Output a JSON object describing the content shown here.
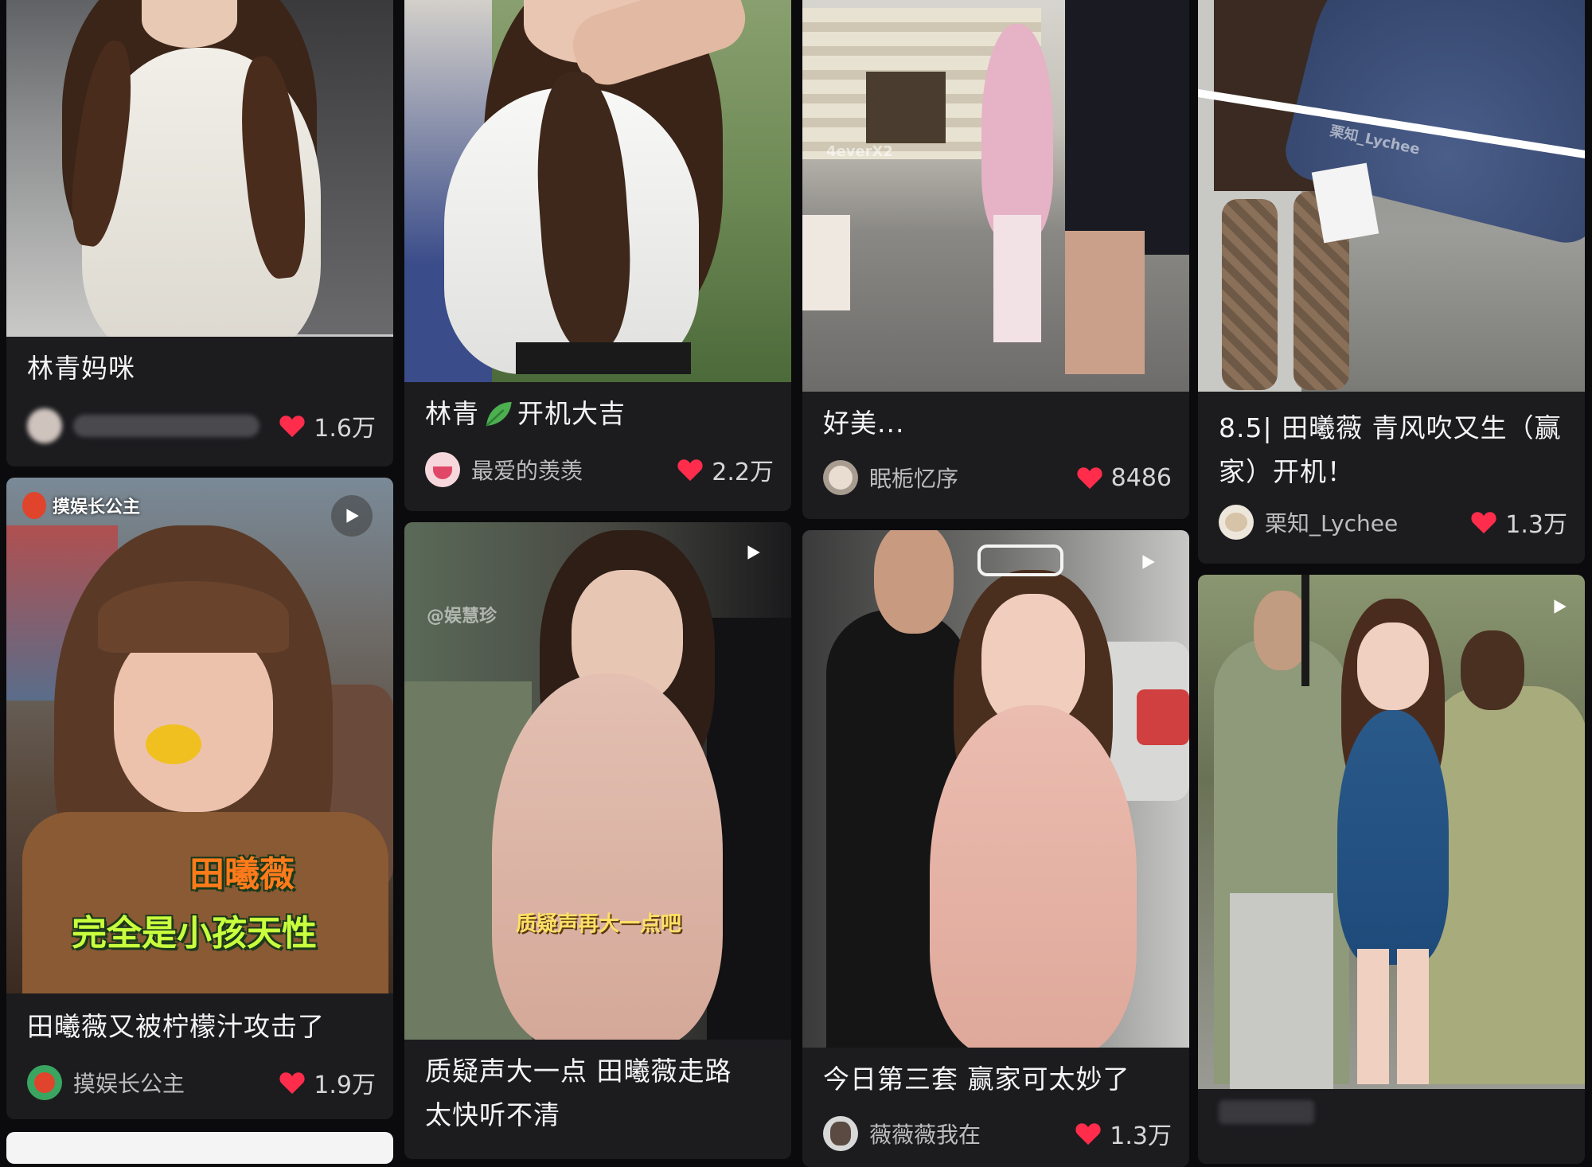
{
  "colors": {
    "background": "#0b0b0d",
    "card": "#1c1c1f",
    "heart": "#ff2d4b",
    "caption_orange": "#ff7a1a",
    "caption_green": "#c9ff3d",
    "caption_yellow": "#ffe066"
  },
  "cards": [
    {
      "title": "林青妈咪",
      "author": "",
      "likes": "1.6万",
      "has_play": false
    },
    {
      "title": "田曦薇又被柠檬汁攻击了",
      "author": "摸娱长公主",
      "likes": "1.9万",
      "has_play": true,
      "overlay_tag": "摸娱长公主",
      "caption_line1": "田曦薇",
      "caption_line2": "完全是小孩天性"
    },
    {
      "title_part1": "林青",
      "title_icon": "leaf-emoji-icon",
      "title_part2": "开机大吉",
      "author": "最爱的羡羡",
      "likes": "2.2万",
      "has_play": false
    },
    {
      "title": "质疑声大一点 田曦薇走路太快听不清",
      "author": "",
      "likes": "",
      "has_play": true,
      "watermark": "@娱慧珍",
      "caption_line1": "质疑声再大一点吧"
    },
    {
      "title": "好美...",
      "author": "眠栀忆序",
      "likes": "8486",
      "has_play": false,
      "watermark": "4everX2"
    },
    {
      "title": "今日第三套 赢家可太妙了",
      "author": "薇薇薇我在",
      "likes": "1.3万",
      "has_play": true
    },
    {
      "title": "8.5| 田曦薇 青风吹又生（赢家）开机！",
      "author": "栗知_Lychee",
      "likes": "1.3万",
      "has_play": false,
      "watermark": "栗知_Lychee"
    },
    {
      "title": "",
      "author": "",
      "likes": "",
      "has_play": true
    }
  ]
}
